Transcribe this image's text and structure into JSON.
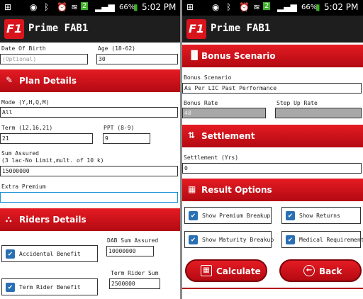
{
  "status": {
    "time": "5:02 PM",
    "battery": "66%",
    "badge": "2",
    "notification_icon": "plus-square-icon",
    "status_icons": [
      "eye-icon",
      "bluetooth-icon",
      "alarm-icon",
      "wifi-icon",
      "signal-icon"
    ]
  },
  "app": {
    "logo": "F1",
    "title": "Prime FAB1"
  },
  "colors": {
    "accent": "#e51b23",
    "accent_dark": "#b30a12",
    "checkbox": "#2a6fb3",
    "bar": "#1e1e1e"
  },
  "left": {
    "dob_label": "Date Of Birth",
    "dob_placeholder": "(Optional)",
    "age_label": "Age (18-62)",
    "age_value": "30",
    "plan_details": {
      "icon": "edit-icon",
      "label": "Plan Details"
    },
    "mode_label": "Mode (Y,H,Q,M)",
    "mode_value": "All",
    "term_label": "Term (12,16,21)",
    "term_value": "21",
    "ppt_label": "PPT (8-9)",
    "ppt_value": "9",
    "sa_label_line1": "Sum Assured",
    "sa_label_line2": "(3 lac-No Limit,mult. of 10 k)",
    "sa_value": "15000000",
    "extra_premium_label": "Extra Premium",
    "extra_premium_value": "",
    "riders": {
      "icon": "riders-icon",
      "label": "Riders Details"
    },
    "accidental_benefit": "Accidental Benefit",
    "dab_label": "DAB Sum Assured",
    "dab_value": "10000000",
    "term_rider_label": "Term Rider Sum",
    "term_rider_value": "2500000",
    "term_rider_benefit": "Term Rider Benefit"
  },
  "right": {
    "bonus": {
      "icon": "chart-icon",
      "label": "Bonus Scenario"
    },
    "bonus_scenario_label": "Bonus Scenario",
    "bonus_scenario_value": "As Per LIC Past Performance",
    "bonus_rate_label": "Bonus Rate",
    "bonus_rate_value": "48",
    "step_up_label": "Step Up Rate",
    "step_up_value": "",
    "settlement": {
      "icon": "settlement-icon",
      "label": "Settlement"
    },
    "settlement_label": "Settlement (Yrs)",
    "settlement_value": "0",
    "result": {
      "icon": "calendar-icon",
      "label": "Result Options"
    },
    "opt_premium_breakup": "Show Premium Breakup",
    "opt_show_returns": "Show Returns",
    "opt_maturity_breakup": "Show Maturity Breakup",
    "opt_medical": "Medical Requirement",
    "calculate": "Calculate",
    "back": "Back"
  }
}
